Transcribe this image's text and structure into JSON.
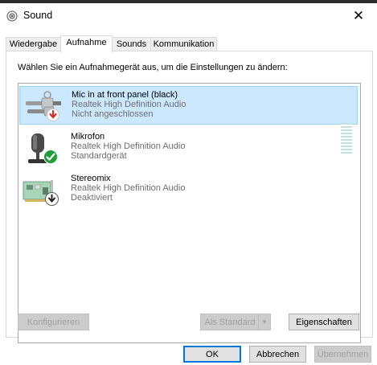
{
  "window": {
    "title": "Sound",
    "close_glyph": "✕"
  },
  "tabs": [
    {
      "label": "Wiedergabe",
      "active": false
    },
    {
      "label": "Aufnahme",
      "active": true
    },
    {
      "label": "Sounds",
      "active": false
    },
    {
      "label": "Kommunikation",
      "active": false
    }
  ],
  "instruction": "Wählen Sie ein Aufnahmegerät aus, um die Einstellungen zu ändern:",
  "devices": [
    {
      "name": "Mic in at front panel (black)",
      "driver": "Realtek High Definition Audio",
      "status": "Nicht angeschlossen",
      "icon": "audio-jack-icon",
      "badge": "unplugged-badge-icon",
      "selected": true
    },
    {
      "name": "Mikrofon",
      "driver": "Realtek High Definition Audio",
      "status": "Standardgerät",
      "icon": "microphone-icon",
      "badge": "default-check-badge-icon",
      "selected": false
    },
    {
      "name": "Stereomix",
      "driver": "Realtek High Definition Audio",
      "status": "Deaktiviert",
      "icon": "sound-card-icon",
      "badge": "disabled-badge-icon",
      "selected": false
    }
  ],
  "buttons": {
    "configure": "Konfigurieren",
    "set_default": "Als Standard",
    "properties": "Eigenschaften",
    "ok": "OK",
    "cancel": "Abbrechen",
    "apply": "Übernehmen"
  },
  "colors": {
    "selection": "#cce8ff",
    "accent": "#0078d7",
    "level_meter": "#bfe3dc"
  }
}
